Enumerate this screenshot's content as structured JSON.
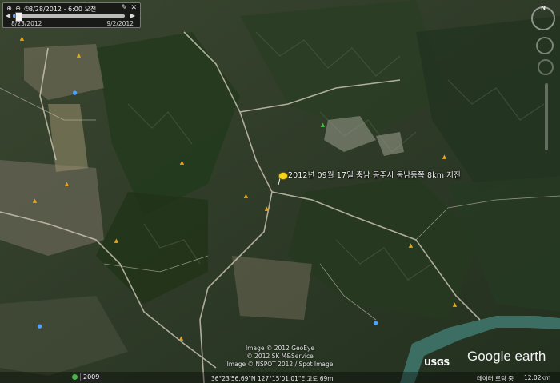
{
  "time_slider": {
    "current_date": "8/28/2012 - 6:00 오전",
    "range_start": "8/23/2012",
    "range_end": "9/2/2012",
    "position": 0.02
  },
  "placemark": {
    "label": "2012년 09월 17일 충남 공주시 동남동쪽 8km 지진",
    "icon": "yellow-pushpin-icon"
  },
  "copyright": {
    "line1": "Image © 2012 GeoEye",
    "line2": "© 2012 SK M&Service",
    "line3": "Image © NSPOT 2012 / Spot Image"
  },
  "status": {
    "imagery_year": "2009",
    "coordinates": "36°23'56.69\"N 127°15'01.01\"E  고도 69m",
    "streaming": "데이터 로딩 중",
    "eye_alt": "12.02km"
  },
  "logos": {
    "usgs": "USGS",
    "google_earth": "Google earth"
  },
  "nav": {
    "north": "N"
  },
  "colors": {
    "pin": "#f5d319",
    "river": "#3c6e64",
    "road": "#c9c2b0",
    "vegetation": "#2f4a24",
    "urban": "#8e8a78"
  }
}
